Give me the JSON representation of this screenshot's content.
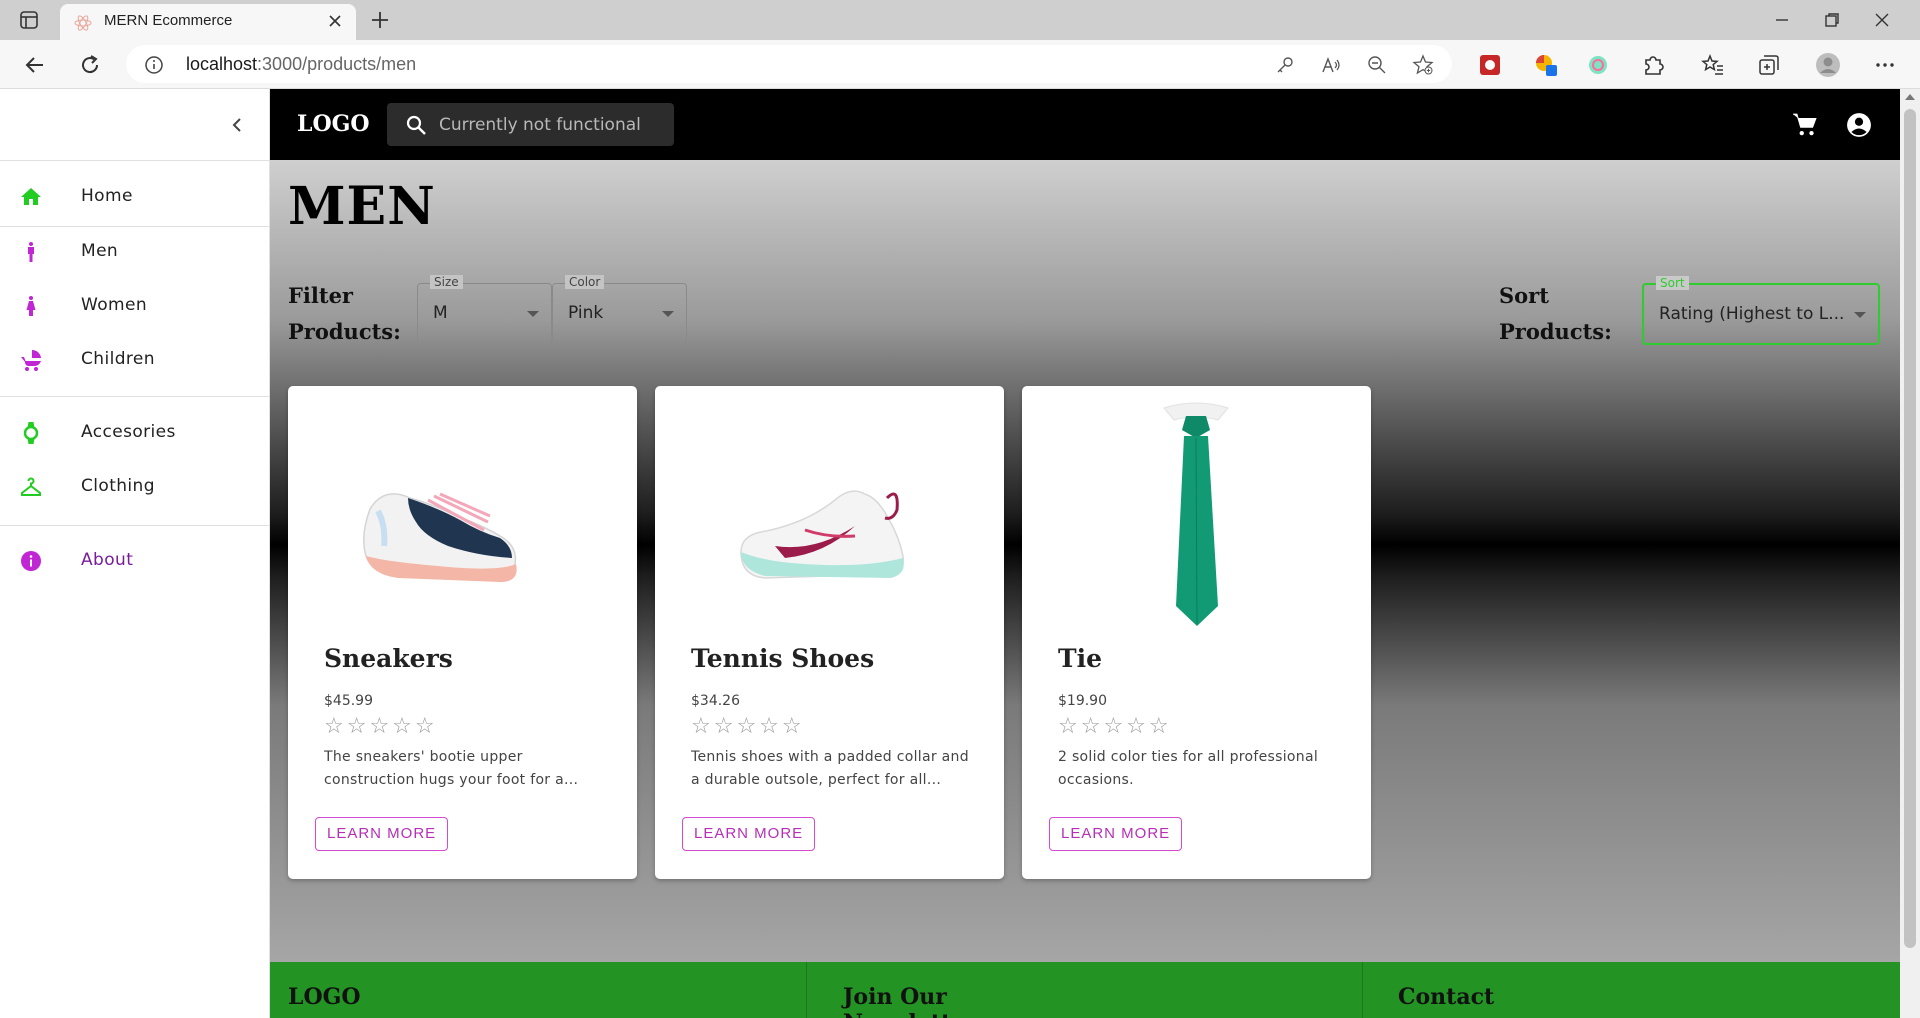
{
  "browser": {
    "tab_title": "MERN Ecommerce",
    "url_host": "localhost",
    "url_rest": ":3000/products/men"
  },
  "sidebar": {
    "items": [
      {
        "label": "Home",
        "icon": "home-icon",
        "color": "#22cc22"
      },
      {
        "label": "Men",
        "icon": "man-icon",
        "color": "#c026d3"
      },
      {
        "label": "Women",
        "icon": "woman-icon",
        "color": "#c026d3"
      },
      {
        "label": "Children",
        "icon": "stroller-icon",
        "color": "#c026d3"
      },
      {
        "label": "Accesories",
        "icon": "watch-icon",
        "color": "#22cc22"
      },
      {
        "label": "Clothing",
        "icon": "hanger-icon",
        "color": "#22cc22"
      },
      {
        "label": "About",
        "icon": "info-icon",
        "color": "#c026d3"
      }
    ]
  },
  "header": {
    "logo": "LOGO",
    "search_placeholder": "Currently not functional"
  },
  "main": {
    "title": "MEN",
    "filter": {
      "label_line1": "Filter",
      "label_line2": "Products:",
      "size": {
        "legend": "Size",
        "value": "M"
      },
      "color": {
        "legend": "Color",
        "value": "Pink"
      }
    },
    "sort": {
      "label_line1": "Sort",
      "label_line2": "Products:",
      "legend": "Sort",
      "value": "Rating (Highest to L..."
    },
    "products": [
      {
        "title": "Sneakers",
        "price": "$45.99",
        "rating": 0,
        "stars": "☆☆☆☆☆",
        "description": "The sneakers' bootie upper construction hugs your foot for a...",
        "button": "LEARN MORE"
      },
      {
        "title": "Tennis Shoes",
        "price": "$34.26",
        "rating": 0,
        "stars": "☆☆☆☆☆",
        "description": "Tennis shoes with a padded collar and a durable outsole, perfect for all...",
        "button": "LEARN MORE"
      },
      {
        "title": "Tie",
        "price": "$19.90",
        "rating": 0,
        "stars": "☆☆☆☆☆",
        "description": "2 solid color ties for all professional occasions.",
        "button": "LEARN MORE"
      }
    ]
  },
  "footer": {
    "logo": "LOGO",
    "newsletter": "Join Our Newsletter",
    "contact": "Contact"
  },
  "colors": {
    "accent_green": "#22cc22",
    "accent_magenta": "#c026d3",
    "footer_green": "#239323"
  }
}
